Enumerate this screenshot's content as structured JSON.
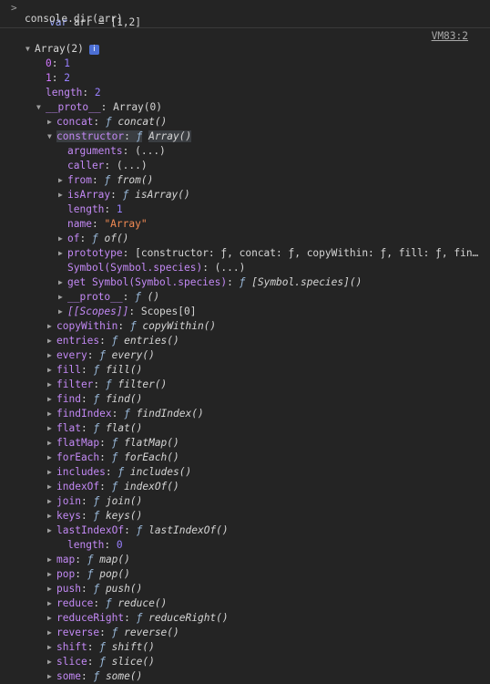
{
  "input": {
    "prompt": ">",
    "line1": {
      "kw": "var",
      "name": " arr ",
      "eq": "=",
      "value": " [1,2]"
    },
    "line2": "console.dir(arr)"
  },
  "source_link": "VM83:2",
  "tree": [
    {
      "indent": 0,
      "tri": "down",
      "key": "Array(2)",
      "key_class": "plain",
      "info": "i"
    },
    {
      "indent": 1,
      "tri": "",
      "key": "0",
      "key_class": "num",
      "sep": ": ",
      "val": "1",
      "val_class": "val-num"
    },
    {
      "indent": 1,
      "tri": "",
      "key": "1",
      "key_class": "num",
      "sep": ": ",
      "val": "2",
      "val_class": "val-num"
    },
    {
      "indent": 1,
      "tri": "",
      "key": "length",
      "key_class": "purp",
      "sep": ": ",
      "val": "2",
      "val_class": "val-num"
    },
    {
      "indent": 1,
      "tri": "down",
      "key": "__proto__",
      "key_class": "purp",
      "sep": ": ",
      "val": "Array(0)",
      "val_class": "plain"
    },
    {
      "indent": 2,
      "tri": "right",
      "key": "concat",
      "key_class": "purp",
      "sep": ": ",
      "f": "ƒ",
      "val": "concat()",
      "val_class": "fn"
    },
    {
      "indent": 2,
      "tri": "down",
      "key": "constructor",
      "key_class": "purp",
      "sep": ": ",
      "f": "ƒ",
      "val": "Array()",
      "val_class": "fn",
      "hl": true
    },
    {
      "indent": 3,
      "tri": "",
      "key": "arguments",
      "key_class": "purp",
      "sep": ": ",
      "val": "(...)",
      "val_class": "plain"
    },
    {
      "indent": 3,
      "tri": "",
      "key": "caller",
      "key_class": "purp",
      "sep": ": ",
      "val": "(...)",
      "val_class": "plain"
    },
    {
      "indent": 3,
      "tri": "right",
      "key": "from",
      "key_class": "purp",
      "sep": ": ",
      "f": "ƒ",
      "val": "from()",
      "val_class": "fn"
    },
    {
      "indent": 3,
      "tri": "right",
      "key": "isArray",
      "key_class": "purp",
      "sep": ": ",
      "f": "ƒ",
      "val": "isArray()",
      "val_class": "fn"
    },
    {
      "indent": 3,
      "tri": "",
      "key": "length",
      "key_class": "purp",
      "sep": ": ",
      "val": "1",
      "val_class": "val-num"
    },
    {
      "indent": 3,
      "tri": "",
      "key": "name",
      "key_class": "purp",
      "sep": ": ",
      "val": "\"Array\"",
      "val_class": "val-str"
    },
    {
      "indent": 3,
      "tri": "right",
      "key": "of",
      "key_class": "purp",
      "sep": ": ",
      "f": "ƒ",
      "val": "of()",
      "val_class": "fn"
    },
    {
      "indent": 3,
      "tri": "right",
      "key": "prototype",
      "key_class": "purp",
      "sep": ": ",
      "val": "[constructor: ƒ, concat: ƒ, copyWithin: ƒ, fill: ƒ, fin…",
      "val_class": "plain"
    },
    {
      "indent": 3,
      "tri": "",
      "key": "Symbol(Symbol.species)",
      "key_class": "purp",
      "sep": ": ",
      "val": "(...)",
      "val_class": "plain"
    },
    {
      "indent": 3,
      "tri": "right",
      "key": "get Symbol(Symbol.species)",
      "key_class": "purp",
      "sep": ": ",
      "f": "ƒ",
      "val": "[Symbol.species]()",
      "val_class": "fn"
    },
    {
      "indent": 3,
      "tri": "right",
      "key": "__proto__",
      "key_class": "purp",
      "sep": ": ",
      "f": "ƒ",
      "val": "()",
      "val_class": "fn"
    },
    {
      "indent": 3,
      "tri": "right",
      "key": "[[Scopes]]",
      "key_class": "purp ital",
      "sep": ": ",
      "val": "Scopes[0]",
      "val_class": "plain"
    },
    {
      "indent": 2,
      "tri": "right",
      "key": "copyWithin",
      "key_class": "purp",
      "sep": ": ",
      "f": "ƒ",
      "val": "copyWithin()",
      "val_class": "fn"
    },
    {
      "indent": 2,
      "tri": "right",
      "key": "entries",
      "key_class": "purp",
      "sep": ": ",
      "f": "ƒ",
      "val": "entries()",
      "val_class": "fn"
    },
    {
      "indent": 2,
      "tri": "right",
      "key": "every",
      "key_class": "purp",
      "sep": ": ",
      "f": "ƒ",
      "val": "every()",
      "val_class": "fn"
    },
    {
      "indent": 2,
      "tri": "right",
      "key": "fill",
      "key_class": "purp",
      "sep": ": ",
      "f": "ƒ",
      "val": "fill()",
      "val_class": "fn"
    },
    {
      "indent": 2,
      "tri": "right",
      "key": "filter",
      "key_class": "purp",
      "sep": ": ",
      "f": "ƒ",
      "val": "filter()",
      "val_class": "fn"
    },
    {
      "indent": 2,
      "tri": "right",
      "key": "find",
      "key_class": "purp",
      "sep": ": ",
      "f": "ƒ",
      "val": "find()",
      "val_class": "fn"
    },
    {
      "indent": 2,
      "tri": "right",
      "key": "findIndex",
      "key_class": "purp",
      "sep": ": ",
      "f": "ƒ",
      "val": "findIndex()",
      "val_class": "fn"
    },
    {
      "indent": 2,
      "tri": "right",
      "key": "flat",
      "key_class": "purp",
      "sep": ": ",
      "f": "ƒ",
      "val": "flat()",
      "val_class": "fn"
    },
    {
      "indent": 2,
      "tri": "right",
      "key": "flatMap",
      "key_class": "purp",
      "sep": ": ",
      "f": "ƒ",
      "val": "flatMap()",
      "val_class": "fn"
    },
    {
      "indent": 2,
      "tri": "right",
      "key": "forEach",
      "key_class": "purp",
      "sep": ": ",
      "f": "ƒ",
      "val": "forEach()",
      "val_class": "fn"
    },
    {
      "indent": 2,
      "tri": "right",
      "key": "includes",
      "key_class": "purp",
      "sep": ": ",
      "f": "ƒ",
      "val": "includes()",
      "val_class": "fn"
    },
    {
      "indent": 2,
      "tri": "right",
      "key": "indexOf",
      "key_class": "purp",
      "sep": ": ",
      "f": "ƒ",
      "val": "indexOf()",
      "val_class": "fn"
    },
    {
      "indent": 2,
      "tri": "right",
      "key": "join",
      "key_class": "purp",
      "sep": ": ",
      "f": "ƒ",
      "val": "join()",
      "val_class": "fn"
    },
    {
      "indent": 2,
      "tri": "right",
      "key": "keys",
      "key_class": "purp",
      "sep": ": ",
      "f": "ƒ",
      "val": "keys()",
      "val_class": "fn"
    },
    {
      "indent": 2,
      "tri": "right",
      "key": "lastIndexOf",
      "key_class": "purp",
      "sep": ": ",
      "f": "ƒ",
      "val": "lastIndexOf()",
      "val_class": "fn"
    },
    {
      "indent": 3,
      "tri": "",
      "key": "length",
      "key_class": "purp",
      "sep": ": ",
      "val": "0",
      "val_class": "val-num"
    },
    {
      "indent": 2,
      "tri": "right",
      "key": "map",
      "key_class": "purp",
      "sep": ": ",
      "f": "ƒ",
      "val": "map()",
      "val_class": "fn"
    },
    {
      "indent": 2,
      "tri": "right",
      "key": "pop",
      "key_class": "purp",
      "sep": ": ",
      "f": "ƒ",
      "val": "pop()",
      "val_class": "fn"
    },
    {
      "indent": 2,
      "tri": "right",
      "key": "push",
      "key_class": "purp",
      "sep": ": ",
      "f": "ƒ",
      "val": "push()",
      "val_class": "fn"
    },
    {
      "indent": 2,
      "tri": "right",
      "key": "reduce",
      "key_class": "purp",
      "sep": ": ",
      "f": "ƒ",
      "val": "reduce()",
      "val_class": "fn"
    },
    {
      "indent": 2,
      "tri": "right",
      "key": "reduceRight",
      "key_class": "purp",
      "sep": ": ",
      "f": "ƒ",
      "val": "reduceRight()",
      "val_class": "fn"
    },
    {
      "indent": 2,
      "tri": "right",
      "key": "reverse",
      "key_class": "purp",
      "sep": ": ",
      "f": "ƒ",
      "val": "reverse()",
      "val_class": "fn"
    },
    {
      "indent": 2,
      "tri": "right",
      "key": "shift",
      "key_class": "purp",
      "sep": ": ",
      "f": "ƒ",
      "val": "shift()",
      "val_class": "fn"
    },
    {
      "indent": 2,
      "tri": "right",
      "key": "slice",
      "key_class": "purp",
      "sep": ": ",
      "f": "ƒ",
      "val": "slice()",
      "val_class": "fn"
    },
    {
      "indent": 2,
      "tri": "right",
      "key": "some",
      "key_class": "purp",
      "sep": ": ",
      "f": "ƒ",
      "val": "some()",
      "val_class": "fn"
    }
  ]
}
